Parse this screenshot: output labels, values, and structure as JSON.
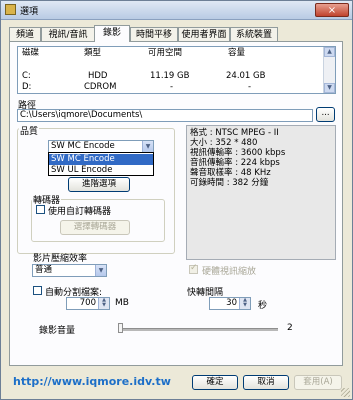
{
  "window": {
    "title": "選項",
    "close_glyph": "×"
  },
  "tabs": [
    {
      "label": "頻道"
    },
    {
      "label": "視訊/音訊"
    },
    {
      "label": "錄影"
    },
    {
      "label": "時間平移"
    },
    {
      "label": "使用者界面"
    },
    {
      "label": "系統裝置"
    }
  ],
  "active_tab": "錄影",
  "drives": {
    "headers": [
      "磁碟",
      "類型",
      "可用空間",
      "容量"
    ],
    "rows": [
      {
        "drive": "C:",
        "type": "HDD",
        "free": "11.19 GB",
        "capacity": "24.01 GB"
      },
      {
        "drive": "D:",
        "type": "CDROM",
        "free": "-",
        "capacity": "-"
      }
    ]
  },
  "path": {
    "label": "路徑",
    "value": "C:\\Users\\iqmore\\Documents\\",
    "browse_label": "..."
  },
  "quality": {
    "label": "品質",
    "selected": "SW MC Encode",
    "options": [
      "SW MC Encode",
      "SW UL Encode"
    ],
    "advanced_button": "進階選項"
  },
  "transcoder": {
    "label": "轉碼器",
    "custom_checkbox": "使用自訂轉碼器",
    "select_button": "選擇轉碼器"
  },
  "format_info": [
    "格式 : NTSC MPEG - II",
    "大小 : 352 * 480",
    "視訊傳輸率 : 3600 kbps",
    "音訊傳輸率 : 224 kbps",
    "聲音取樣率 : 48 KHz",
    "可錄時間 : 382 分鐘"
  ],
  "compression": {
    "label": "影片壓縮效率",
    "selected": "普通"
  },
  "hw_scaling": {
    "label": "硬體視訊縮放",
    "checked": true,
    "enabled": false
  },
  "auto_split": {
    "label": "自動分割檔案:",
    "value": "700",
    "unit": "MB"
  },
  "quick_jump": {
    "label": "快轉間隔",
    "value": "30",
    "unit": "秒"
  },
  "record_volume": {
    "label": "錄影音量",
    "value": "2",
    "level": 0.0
  },
  "footer": {
    "url": "http://www.iqmore.idv.tw",
    "ok": "確定",
    "cancel": "取消",
    "apply": "套用(A)"
  },
  "colors": {
    "selection": "#316ac5",
    "url": "#1d6fc8",
    "close": "#c0432e"
  }
}
